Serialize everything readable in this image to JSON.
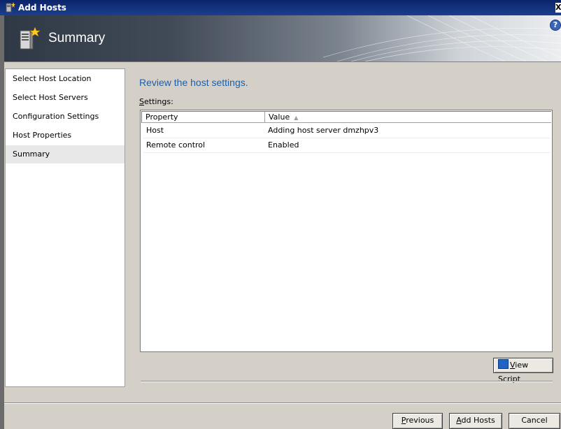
{
  "window": {
    "title": "Add Hosts",
    "close_glyph": "X"
  },
  "banner": {
    "title": "Summary",
    "help_glyph": "?"
  },
  "nav": {
    "items": [
      {
        "label": "Select Host Location"
      },
      {
        "label": "Select Host Servers"
      },
      {
        "label": "Configuration Settings"
      },
      {
        "label": "Host Properties"
      },
      {
        "label": "Summary",
        "selected": true
      }
    ]
  },
  "main": {
    "heading": "Review the host settings.",
    "settings_label_accel": "S",
    "settings_label_rest": "ettings:",
    "columns": {
      "property": "Property",
      "value": "Value"
    },
    "rows": [
      {
        "property": "Host",
        "value": "Adding host server dmzhpv3"
      },
      {
        "property": "Remote control",
        "value": "Enabled"
      }
    ]
  },
  "buttons": {
    "view_script_accel": "V",
    "view_script_rest": "iew Script",
    "previous_accel": "P",
    "previous_rest": "revious",
    "add_hosts_accel": "A",
    "add_hosts_rest": "dd Hosts",
    "cancel": "Cancel"
  },
  "colors": {
    "heading": "#1f5fa8",
    "titlebar": "#0a246a",
    "face": "#d4d0c8"
  },
  "icons": [
    "window-app-icon",
    "server-wizard-icon",
    "help-icon",
    "sort-ascending-icon",
    "powershell-icon"
  ]
}
